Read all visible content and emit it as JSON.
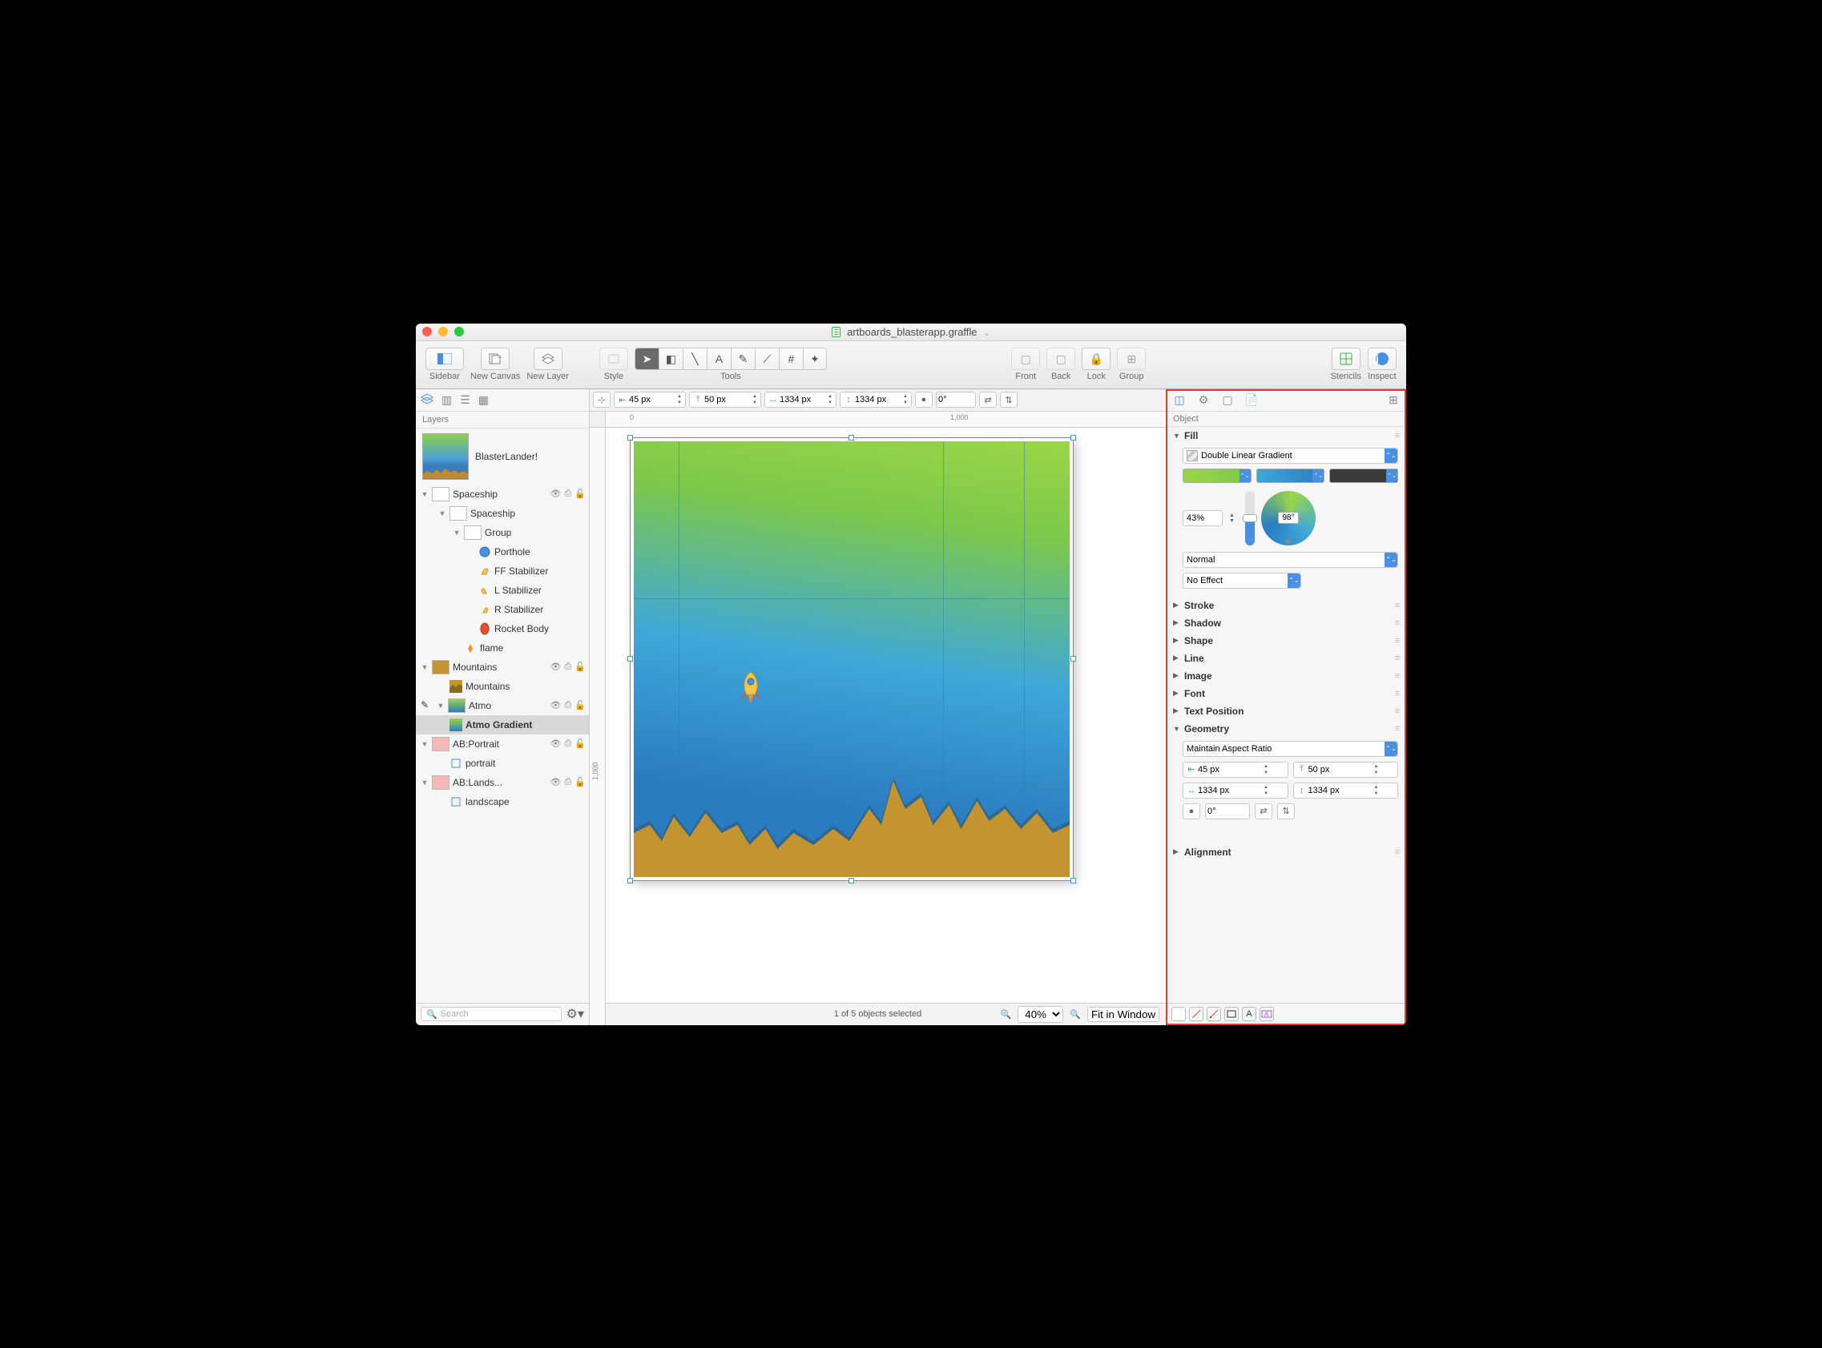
{
  "title": "artboards_blasterapp.graffle",
  "toolbar": {
    "sidebar": "Sidebar",
    "new_canvas": "New Canvas",
    "new_layer": "New Layer",
    "style": "Style",
    "tools": "Tools",
    "front": "Front",
    "back": "Back",
    "lock": "Lock",
    "group": "Group",
    "stencils": "Stencils",
    "inspect": "Inspect"
  },
  "geometry_bar": {
    "x": "45 px",
    "y": "50 px",
    "w": "1334 px",
    "h": "1334 px",
    "rot": "0°"
  },
  "sidebar": {
    "title": "Layers",
    "canvas_name": "BlasterLander!",
    "search_placeholder": "Search",
    "layers": [
      {
        "name": "Spaceship",
        "lv": 0,
        "type": "layer",
        "icons": true
      },
      {
        "name": "Spaceship",
        "lv": 1,
        "type": "group"
      },
      {
        "name": "Group",
        "lv": 2,
        "type": "group"
      },
      {
        "name": "Porthole",
        "lv": 3,
        "type": "shape",
        "ico": "porthole"
      },
      {
        "name": "FF Stabilizer",
        "lv": 3,
        "type": "shape",
        "ico": "fin"
      },
      {
        "name": "L Stabilizer",
        "lv": 3,
        "type": "shape",
        "ico": "finl"
      },
      {
        "name": "R Stabilizer",
        "lv": 3,
        "type": "shape",
        "ico": "finr"
      },
      {
        "name": "Rocket Body",
        "lv": 3,
        "type": "shape",
        "ico": "body"
      },
      {
        "name": "flame",
        "lv": 2,
        "type": "shape",
        "ico": "flame"
      },
      {
        "name": "Mountains",
        "lv": 0,
        "type": "layer",
        "icons": true
      },
      {
        "name": "Mountains",
        "lv": 1,
        "type": "shape",
        "ico": "mtn"
      },
      {
        "name": "Atmo",
        "lv": 0,
        "type": "layer",
        "icons": true,
        "selected": false,
        "edit": true
      },
      {
        "name": "Atmo Gradient",
        "lv": 1,
        "type": "shape",
        "ico": "atmo",
        "selected": true,
        "bold": true
      },
      {
        "name": "AB:Portrait",
        "lv": 0,
        "type": "layer",
        "icons": true,
        "ab": true
      },
      {
        "name": "portrait",
        "lv": 1,
        "type": "shape",
        "ico": "rect"
      },
      {
        "name": "AB:Lands...",
        "lv": 0,
        "type": "layer",
        "icons": true,
        "ab": true
      },
      {
        "name": "landscape",
        "lv": 1,
        "type": "shape",
        "ico": "rect"
      }
    ]
  },
  "status": {
    "selection": "1 of 5 objects selected",
    "zoom": "40%",
    "fit": "Fit in Window"
  },
  "inspector": {
    "title": "Object",
    "fill": {
      "label": "Fill",
      "type": "Double Linear Gradient",
      "color1": "#9ad648",
      "color2": "#3fa8d8",
      "color3": "#3a3a3a",
      "midpoint": "43%",
      "angle": "98°",
      "blend": "Normal",
      "effect": "No Effect"
    },
    "sections": [
      "Stroke",
      "Shadow",
      "Shape",
      "Line",
      "Image",
      "Font",
      "Text Position"
    ],
    "geometry": {
      "label": "Geometry",
      "aspect": "Maintain Aspect Ratio",
      "x": "45 px",
      "y": "50 px",
      "w": "1334 px",
      "h": "1334 px",
      "rot": "0°"
    },
    "alignment": "Alignment"
  },
  "ruler": {
    "zero": "0",
    "thousand": "1,000",
    "vthousand": "1,000"
  }
}
